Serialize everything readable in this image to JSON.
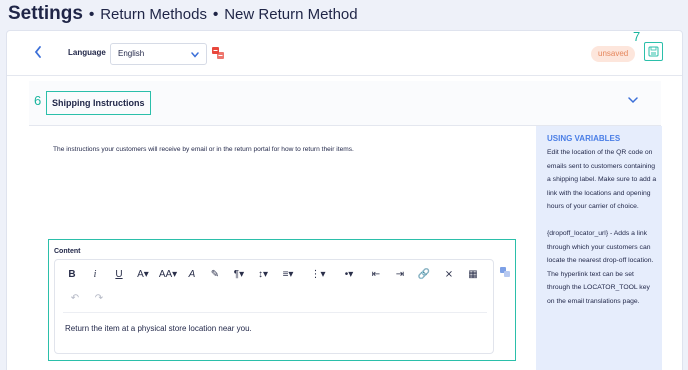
{
  "breadcrumb": {
    "root": "Settings",
    "sep": "•",
    "items": [
      "Return Methods",
      "New Return Method"
    ]
  },
  "toolbar": {
    "back_icon": "chevron-left-icon",
    "language_label": "Language",
    "language_value": "English",
    "status_badge": "unsaved",
    "step_save": "7"
  },
  "section": {
    "step": "6",
    "title": "Shipping Instructions",
    "description": "The instructions your customers will receive by email or in the return portal for how to return their items."
  },
  "editor": {
    "content_label": "Content",
    "toolbar": [
      "B",
      "i",
      "U",
      "A▾",
      "AA▾",
      "A",
      "✎",
      "¶▾",
      "↕▾",
      "≡▾",
      "⋮▾",
      "•▾",
      "⇤",
      "⇥",
      "🔗",
      "⨯",
      "▦"
    ],
    "history": [
      "↶",
      "↷"
    ],
    "body_text": "Return the item at a physical store location near you."
  },
  "variables": {
    "title": "USING VARIABLES",
    "text": "Edit the location of the QR code on emails sent to customers containing a shipping label. Make sure to add a link with the locations and opening hours of your carrier of choice.",
    "text2": "{dropoff_locator_url} - Adds a link through which your customers can locate the nearest drop-off location. The hyperlink text can be set through the LOCATOR_TOOL key on the email translations page."
  },
  "colors": {
    "accent": "#2bbfaa",
    "link": "#3b6fd8",
    "badge_bg": "#fde6dc",
    "badge_text": "#e5875d",
    "panel_bg": "#e6edfc"
  }
}
